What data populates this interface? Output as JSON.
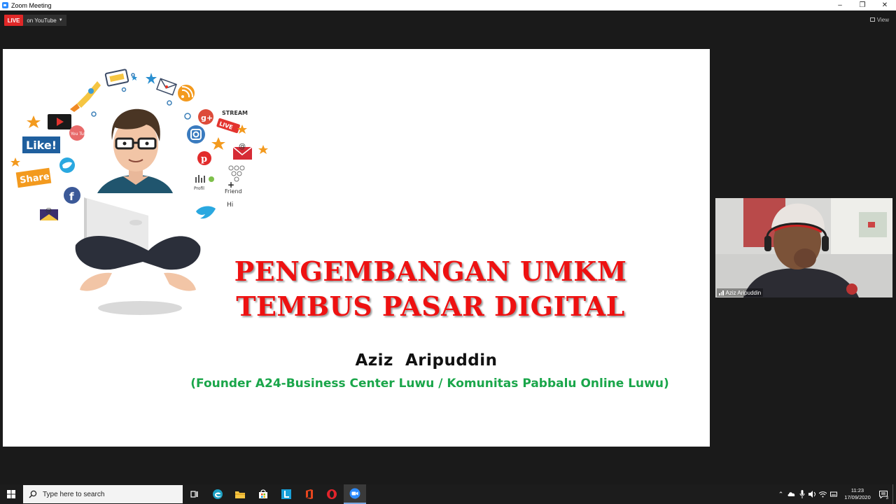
{
  "window": {
    "title": "Zoom Meeting"
  },
  "header": {
    "live_badge": "LIVE",
    "live_destination": "on YouTube",
    "view_label": "View"
  },
  "slide": {
    "title_line1": "PENGEMBANGAN UMKM",
    "title_line2": "TEMBUS PASAR DIGITAL",
    "presenter": "Aziz  Aripuddin",
    "affiliation": "(Founder A24-Business Center Luwu / Komunitas Pabbalu Online Luwu)",
    "illustration_labels": {
      "like": "Like!",
      "share": "Share",
      "stream": "STREAM",
      "live": "LIVE",
      "friend": "Friend",
      "hi": "Hi",
      "profil": "Profil",
      "youtube": "You Tube"
    },
    "colors": {
      "title": "#ee1111",
      "affiliation": "#1aa64a"
    }
  },
  "participant": {
    "name": "Aziz Aripuddin"
  },
  "taskbar": {
    "search_placeholder": "Type here to search",
    "clock_time": "11:23",
    "clock_date": "17/09/2020",
    "notification_count": "3",
    "pinned_apps": [
      "task-view",
      "edge",
      "file-explorer",
      "store",
      "l-app",
      "office",
      "opera",
      "zoom"
    ]
  }
}
